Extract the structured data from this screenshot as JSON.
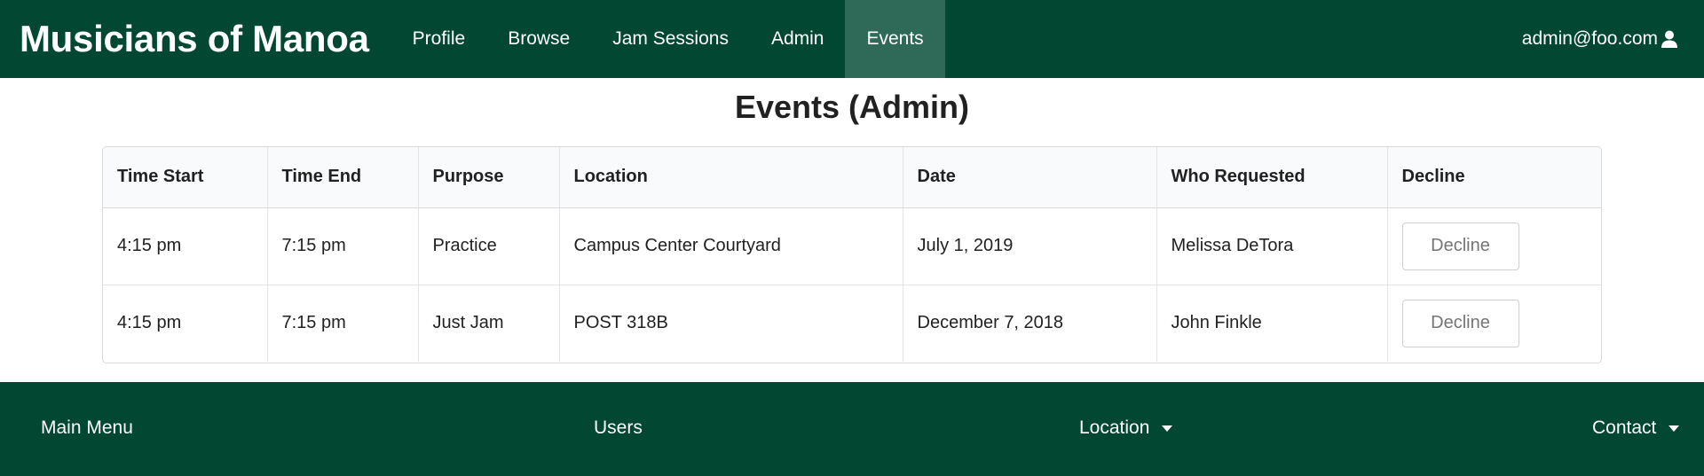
{
  "navbar": {
    "brand": "Musicians of Manoa",
    "items": [
      {
        "label": "Profile"
      },
      {
        "label": "Browse"
      },
      {
        "label": "Jam Sessions"
      },
      {
        "label": "Admin"
      },
      {
        "label": "Events"
      }
    ],
    "active": "Events",
    "user_email": "admin@foo.com",
    "user_icon": "user-icon"
  },
  "page": {
    "title": "Events (Admin)"
  },
  "table": {
    "headers": [
      "Time Start",
      "Time End",
      "Purpose",
      "Location",
      "Date",
      "Who Requested",
      "Decline"
    ],
    "rows": [
      {
        "time_start": "4:15 pm",
        "time_end": "7:15 pm",
        "purpose": "Practice",
        "location": "Campus Center Courtyard",
        "date": "July 1, 2019",
        "who_requested": "Melissa DeTora",
        "decline_label": "Decline"
      },
      {
        "time_start": "4:15 pm",
        "time_end": "7:15 pm",
        "purpose": "Just Jam",
        "location": "POST 318B",
        "date": "December 7, 2018",
        "who_requested": "John Finkle",
        "decline_label": "Decline"
      }
    ]
  },
  "footer": {
    "main_menu": "Main Menu",
    "users": "Users",
    "location": "Location",
    "contact": "Contact"
  },
  "colors": {
    "brand_green": "#024731",
    "active_tab": "#2e6a57"
  }
}
